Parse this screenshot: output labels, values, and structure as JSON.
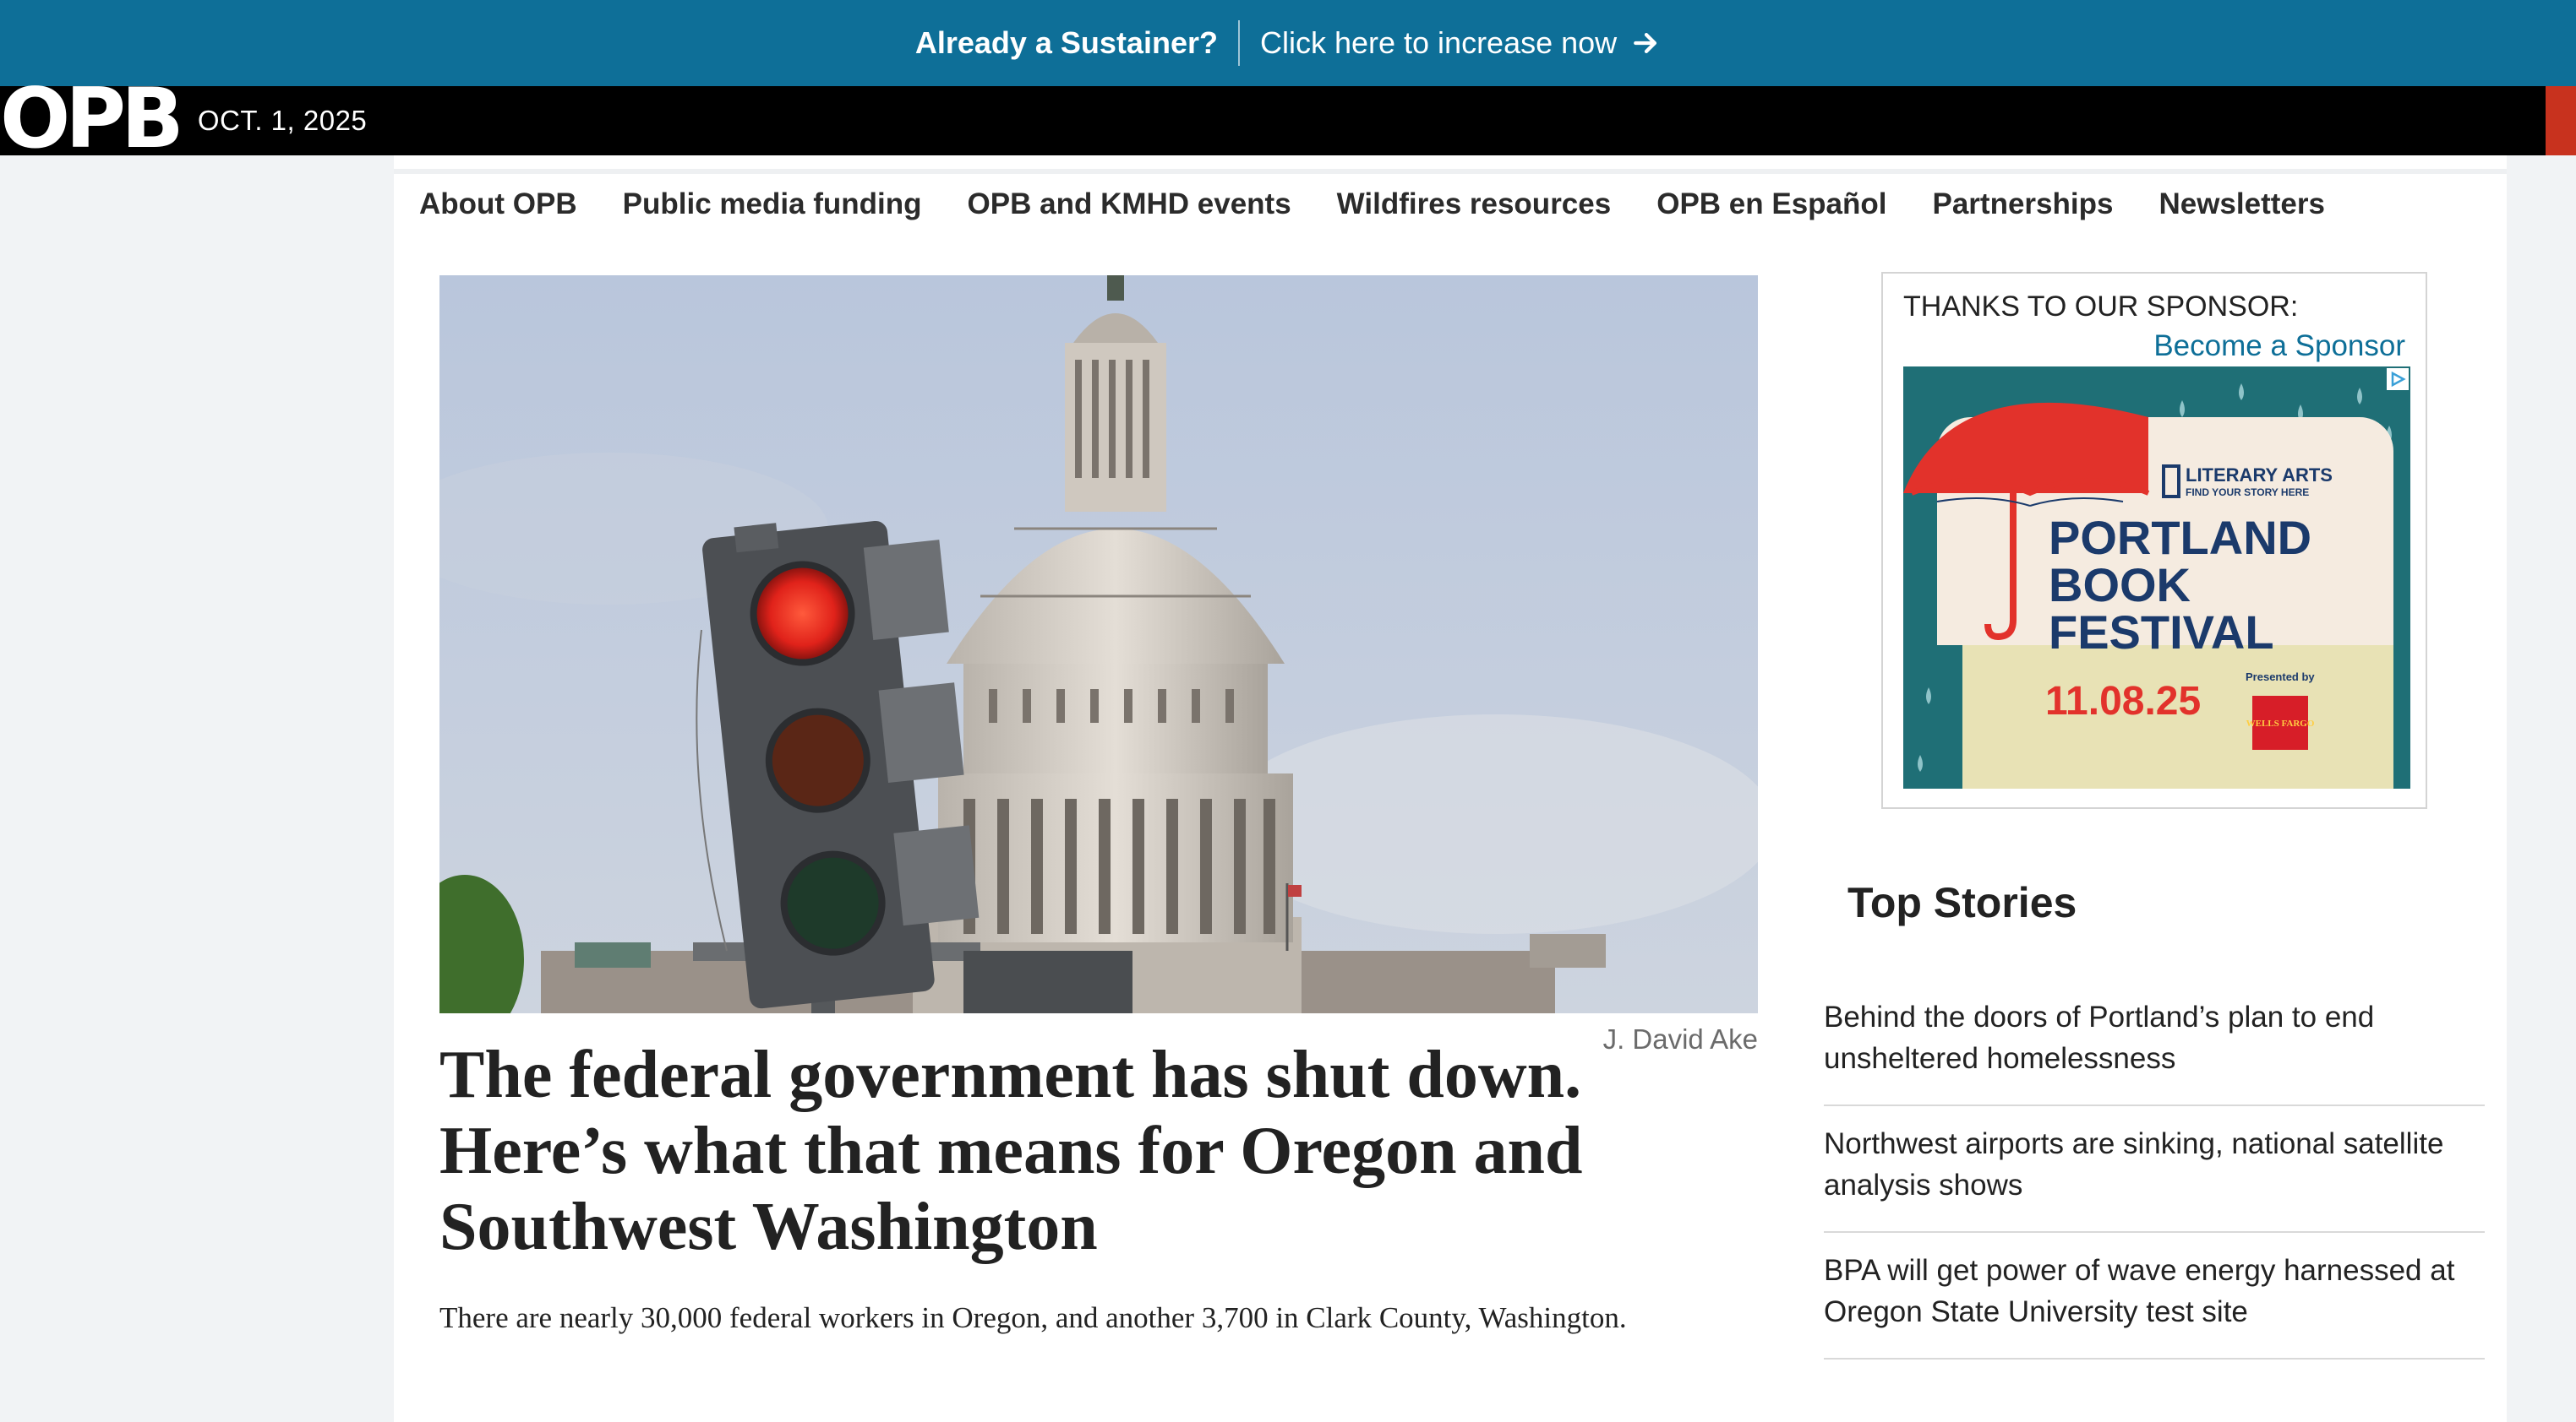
{
  "promo": {
    "question": "Already a Sustainer?",
    "link_label": "Click here to increase now"
  },
  "masthead": {
    "logo": "OPB",
    "date": "OCT. 1, 2025"
  },
  "subnav": {
    "items": [
      "About OPB",
      "Public media funding",
      "OPB and KMHD events",
      "Wildfires resources",
      "OPB en Español",
      "Partnerships",
      "Newsletters"
    ]
  },
  "article": {
    "photo_credit": "J. David Ake",
    "headline": "The federal government has shut down. Here’s what that means for Oregon and Southwest Washington",
    "dek": "There are nearly 30,000 federal workers in Oregon, and another 3,700 in Clark County, Washington."
  },
  "sponsor": {
    "thanks": "THANKS TO OUR SPONSOR:",
    "become": "Become a Sponsor",
    "ad": {
      "brand": "LITERARY ARTS",
      "tagline": "FIND YOUR STORY HERE",
      "line1": "PORTLAND",
      "line2": "BOOK",
      "line3": "FESTIVAL",
      "date": "11.08.25",
      "presented": "Presented by",
      "presenter": "WELLS FARGO"
    }
  },
  "top_stories": {
    "title": "Top Stories",
    "items": [
      "Behind the doors of Portland’s plan to end unsheltered homelessness",
      "Northwest airports are sinking, national satellite analysis shows",
      "BPA will get power of wave energy harnessed at Oregon State University test site"
    ]
  },
  "colors": {
    "promo_bg": "#0e6f98",
    "link": "#0e6f98",
    "ad_teal": "#1f6f76",
    "ad_red": "#e2322b",
    "ad_navy": "#1b3a6b"
  }
}
